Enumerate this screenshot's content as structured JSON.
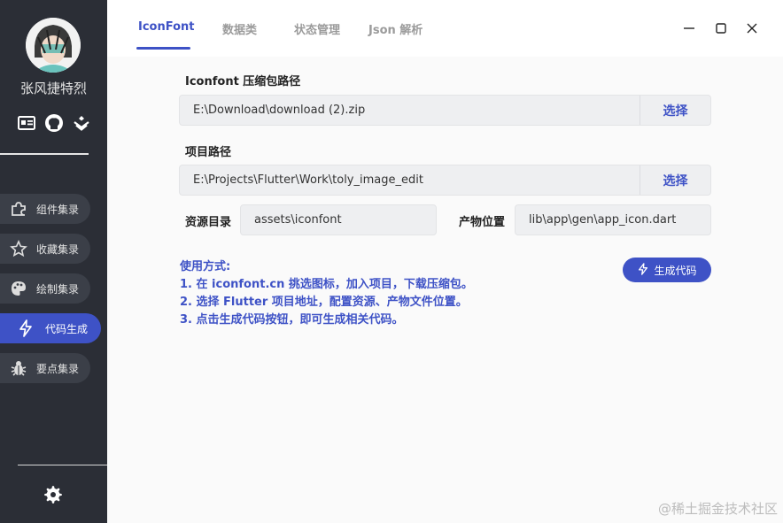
{
  "sidebar": {
    "username": "张风捷特烈",
    "social_icons": [
      "id-card-icon",
      "github-icon",
      "juejin-icon"
    ],
    "items": [
      {
        "label": "组件集录",
        "icon": "puzzle-icon",
        "active": false
      },
      {
        "label": "收藏集录",
        "icon": "star-icon",
        "active": false
      },
      {
        "label": "绘制集录",
        "icon": "palette-icon",
        "active": false
      },
      {
        "label": "代码生成",
        "icon": "bolt-icon",
        "active": true
      },
      {
        "label": "要点集录",
        "icon": "bug-icon",
        "active": false
      }
    ],
    "settings_icon": "gear-icon"
  },
  "tabs": [
    "IconFont",
    "数据类",
    "状态管理",
    "Json 解析"
  ],
  "active_tab": "IconFont",
  "window_controls": [
    "minimize-icon",
    "maximize-icon",
    "close-icon"
  ],
  "form": {
    "zip_label": "Iconfont 压缩包路径",
    "zip_value": "E:\\Download\\download (2).zip",
    "zip_button": "选择",
    "project_label": "项目路径",
    "project_value": "E:\\Projects\\Flutter\\Work\\toly_image_edit",
    "project_button": "选择",
    "assets_label": "资源目录",
    "assets_value": "assets\\iconfont",
    "output_label": "产物位置",
    "output_value": "lib\\app\\gen\\app_icon.dart"
  },
  "usage": {
    "title": "使用方式:",
    "steps": [
      "1. 在 iconfont.cn 挑选图标，加入项目，下载压缩包。",
      "2. 选择 Flutter 项目地址，配置资源、产物文件位置。",
      "3. 点击生成代码按钮，即可生成相关代码。"
    ]
  },
  "generate_button": "生成代码",
  "watermark": "@稀土掘金技术社区",
  "colors": {
    "accent": "#3e52c6",
    "sidebar_bg": "#2b2e36"
  }
}
